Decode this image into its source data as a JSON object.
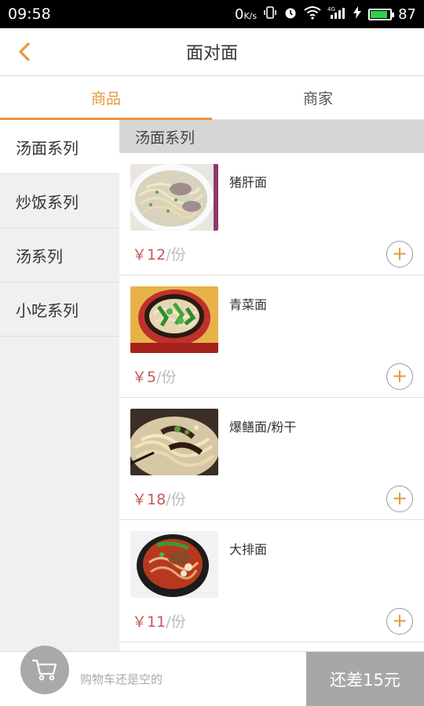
{
  "status": {
    "time": "09:58",
    "network_speed": "0",
    "speed_unit": "K/s",
    "signal": "4G",
    "battery": "87",
    "battery_level": 0.87
  },
  "header": {
    "title": "面对面",
    "back_icon": "chevron-left-icon"
  },
  "tabs": [
    {
      "label": "商品",
      "active": true
    },
    {
      "label": "商家",
      "active": false
    }
  ],
  "sidebar": {
    "items": [
      {
        "label": "汤面系列",
        "active": true
      },
      {
        "label": "炒饭系列",
        "active": false
      },
      {
        "label": "汤系列",
        "active": false
      },
      {
        "label": "小吃系列",
        "active": false
      }
    ]
  },
  "section": {
    "title": "汤面系列"
  },
  "products": [
    {
      "name": "猪肝面",
      "price": "￥12",
      "unit": "/份",
      "image": "soup-noodles-pork-liver"
    },
    {
      "name": "青菜面",
      "price": "￥5",
      "unit": "/份",
      "image": "vegetable-noodles-bowl"
    },
    {
      "name": "爆鳝面/粉干",
      "price": "￥18",
      "unit": "/份",
      "image": "eel-noodles"
    },
    {
      "name": "大排面",
      "price": "￥11",
      "unit": "/份",
      "image": "pork-chop-noodles"
    }
  ],
  "cart": {
    "empty_text": "购物车还是空的",
    "checkout_label": "还差15元"
  },
  "colors": {
    "accent": "#e8973a",
    "price": "#c8565a",
    "checkout_bg": "#a7a7a7"
  }
}
